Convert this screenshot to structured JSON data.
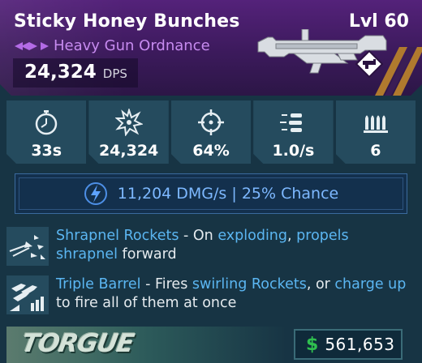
{
  "header": {
    "title": "Sticky Honey Bunches",
    "level": "Lvl 60",
    "rarity_icon": "rarity-chevrons-icon",
    "subtitle": "Heavy Gun Ordnance",
    "dps_value": "24,324",
    "dps_unit": "DPS",
    "weapon_image": "heavy-weapon-launcher",
    "weapon_badge_icon": "weapon-type-badge-icon"
  },
  "stats": [
    {
      "icon": "stopwatch-icon",
      "value": "33s"
    },
    {
      "icon": "explosion-damage-icon",
      "value": "24,324"
    },
    {
      "icon": "crosshair-icon",
      "value": "64%"
    },
    {
      "icon": "fire-rate-icon",
      "value": "1.0/s"
    },
    {
      "icon": "ammo-icon",
      "value": "6"
    }
  ],
  "element": {
    "icon": "lightning-bolt-icon",
    "text": "11,204 DMG/s | 25% Chance"
  },
  "perks": [
    {
      "icon": "shrapnel-icon",
      "name": "Shrapnel Rockets",
      "sep": " - On ",
      "k1": "exploding",
      "t1": ", ",
      "k2": "propels",
      "t2": " ",
      "k3": "shrapnel",
      "t3": " forward"
    },
    {
      "icon": "triple-barrel-icon",
      "name": "Triple Barrel",
      "sep": " - Fires ",
      "k1": "swirling Rockets",
      "t1": ", or ",
      "k2": "charge up",
      "t2": " to fire all of them at once"
    }
  ],
  "footer": {
    "manufacturer": "TORGUE",
    "currency_symbol": "$",
    "price": "561,653"
  },
  "colors": {
    "header_purple": "#4a1f6e",
    "keyword_blue": "#5bb6f2",
    "element_blue": "#7db8ff",
    "money_green": "#2fbf4f",
    "stat_panel": "#254b5e"
  }
}
